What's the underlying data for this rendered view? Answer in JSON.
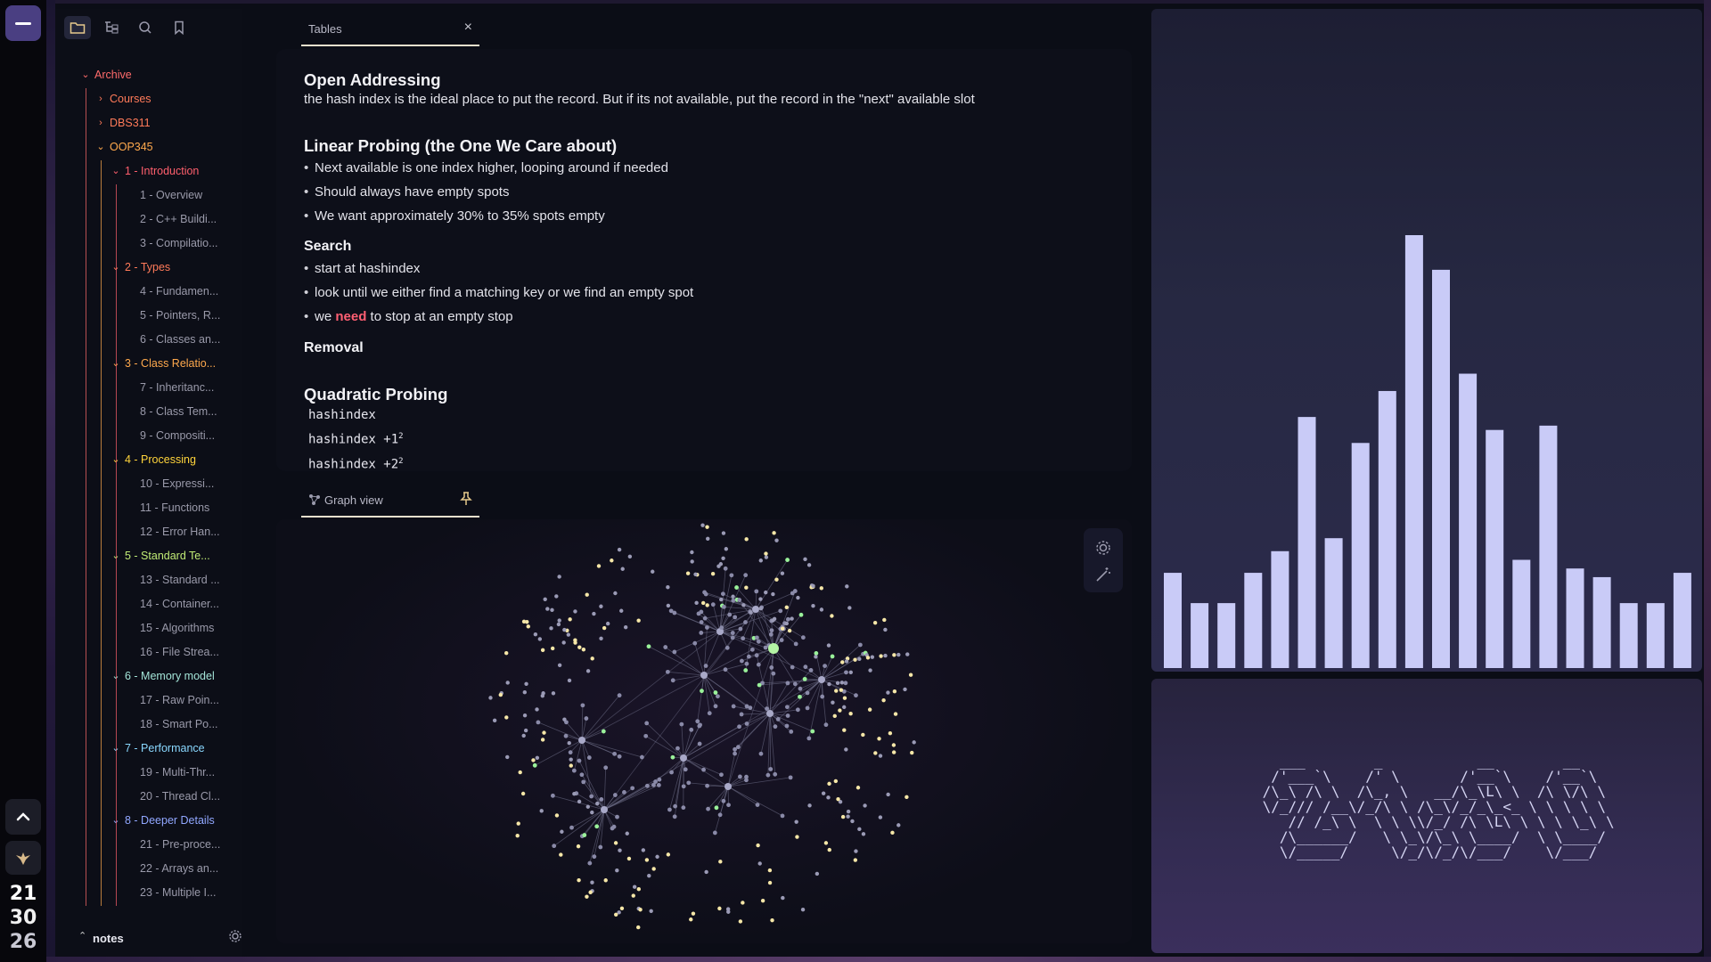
{
  "clock": {
    "hour": "21",
    "minute": "30",
    "second": "26"
  },
  "sidebar": {
    "vault_name": "notes",
    "tree": [
      {
        "depth": 0,
        "type": "folder",
        "open": true,
        "label": "Archive",
        "color": "#ff6b6b"
      },
      {
        "depth": 1,
        "type": "folder",
        "open": false,
        "label": "Courses",
        "color": "#ff7a59"
      },
      {
        "depth": 1,
        "type": "folder",
        "open": false,
        "label": "DBS311",
        "color": "#ff7a59"
      },
      {
        "depth": 1,
        "type": "folder",
        "open": true,
        "label": "OOP345",
        "color": "#ffa94d"
      },
      {
        "depth": 2,
        "type": "folder",
        "open": true,
        "label": "1 - Introduction",
        "color": "#ff5f6d"
      },
      {
        "depth": 3,
        "type": "file",
        "label": "1 - Overview"
      },
      {
        "depth": 3,
        "type": "file",
        "label": "2 - C++ Buildi..."
      },
      {
        "depth": 3,
        "type": "file",
        "label": "3 - Compilatio..."
      },
      {
        "depth": 2,
        "type": "folder",
        "open": true,
        "label": "2 - Types",
        "color": "#ff7a59"
      },
      {
        "depth": 3,
        "type": "file",
        "label": "4 - Fundamen..."
      },
      {
        "depth": 3,
        "type": "file",
        "label": "5 - Pointers, R..."
      },
      {
        "depth": 3,
        "type": "file",
        "label": "6 - Classes an..."
      },
      {
        "depth": 2,
        "type": "folder",
        "open": true,
        "label": "3 - Class Relatio...",
        "color": "#ffa94d"
      },
      {
        "depth": 3,
        "type": "file",
        "label": "7 - Inheritanc..."
      },
      {
        "depth": 3,
        "type": "file",
        "label": "8 - Class Tem..."
      },
      {
        "depth": 3,
        "type": "file",
        "label": "9 - Compositi..."
      },
      {
        "depth": 2,
        "type": "folder",
        "open": true,
        "label": "4 - Processing",
        "color": "#ffd43b"
      },
      {
        "depth": 3,
        "type": "file",
        "label": "10 - Expressi..."
      },
      {
        "depth": 3,
        "type": "file",
        "label": "11 - Functions"
      },
      {
        "depth": 3,
        "type": "file",
        "label": "12 - Error Han..."
      },
      {
        "depth": 2,
        "type": "folder",
        "open": true,
        "label": "5 - Standard Te...",
        "color": "#c0eb75"
      },
      {
        "depth": 3,
        "type": "file",
        "label": "13 - Standard ..."
      },
      {
        "depth": 3,
        "type": "file",
        "label": "14 - Container..."
      },
      {
        "depth": 3,
        "type": "file",
        "label": "15 - Algorithms"
      },
      {
        "depth": 3,
        "type": "file",
        "label": "16 - File Strea..."
      },
      {
        "depth": 2,
        "type": "folder",
        "open": true,
        "label": "6 - Memory model",
        "color": "#a3e4d7"
      },
      {
        "depth": 3,
        "type": "file",
        "label": "17 - Raw Poin..."
      },
      {
        "depth": 3,
        "type": "file",
        "label": "18 - Smart Po..."
      },
      {
        "depth": 2,
        "type": "folder",
        "open": true,
        "label": "7 - Performance",
        "color": "#8ad8ff"
      },
      {
        "depth": 3,
        "type": "file",
        "label": "19 - Multi-Thr..."
      },
      {
        "depth": 3,
        "type": "file",
        "label": "20 - Thread Cl..."
      },
      {
        "depth": 2,
        "type": "folder",
        "open": true,
        "label": "8 - Deeper Details",
        "color": "#91a7ff"
      },
      {
        "depth": 3,
        "type": "file",
        "label": "21 - Pre-proce..."
      },
      {
        "depth": 3,
        "type": "file",
        "label": "22 - Arrays an..."
      },
      {
        "depth": 3,
        "type": "file",
        "label": "23 - Multiple I..."
      }
    ]
  },
  "editor": {
    "tab_title": "Tables",
    "h_open": "Open Addressing",
    "p_open": "the hash index is the ideal place to put the record. But if its not available, put the record in the \"next\" available slot",
    "h_linear": "Linear Probing (the One We Care about)",
    "linear_1": "Next available is one index higher, looping around if needed",
    "linear_2": "Should always have empty spots",
    "linear_3": "We want approximately 30% to 35% spots empty",
    "h_search": "Search",
    "search_1": "start at hashindex",
    "search_2": "look until we either find a matching key or we find an empty spot",
    "search_3_pre": "we ",
    "search_3_hl": "need",
    "search_3_post": " to stop at an empty stop",
    "h_removal": "Removal",
    "h_quad": "Quadratic Probing",
    "code_1": "hashindex",
    "code_2": "hashindex +1",
    "code_2_sup": "2",
    "code_3": "hashindex +2",
    "code_3_sup": "2"
  },
  "graph": {
    "tab_title": "Graph view"
  },
  "visualizer": {
    "bar_levels": [
      0.22,
      0.15,
      0.15,
      0.22,
      0.27,
      0.58,
      0.3,
      0.52,
      0.64,
      1.0,
      0.92,
      0.68,
      0.55,
      0.25,
      0.56,
      0.23,
      0.21,
      0.15,
      0.15,
      0.22
    ],
    "bar_color": "#c9cbf7"
  },
  "ascii_art": "   ___        _           __        __\n  /'___`\\    /' \\       /'__`\\    /'__`\\\n /\\_\\ /\\ \\  /\\_, \\   __/\\_\\L\\ \\  /\\ \\/\\ \\\n \\/_/// /__\\/_/\\ \\ /\\_\\/_/_\\_<_ \\ \\ \\ \\ \\\n    // /_\\ \\  \\ \\ \\\\/_/ /\\ \\L\\ \\ \\ \\ \\_\\ \\\n   /\\______/   \\ \\_\\/\\_\\ \\____/  \\ \\____/\n   \\/_____/     \\/_/\\/_/\\/___/    \\/___/"
}
